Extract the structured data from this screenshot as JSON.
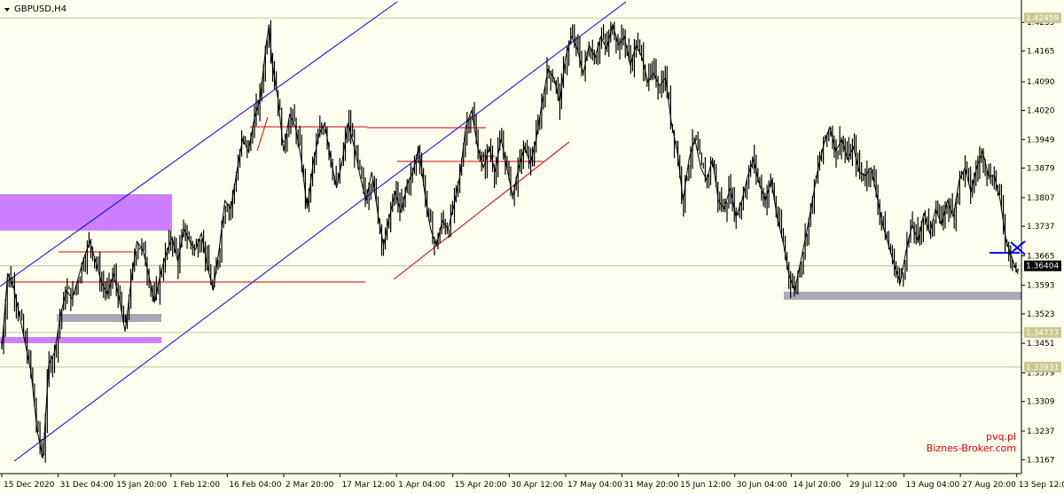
{
  "chart_data": {
    "type": "line",
    "title": "GBPUSD,H4",
    "xlabel": "",
    "ylabel": "",
    "ylim": [
      1.3133,
      1.4281
    ],
    "grid": false,
    "legend": "none",
    "x_ticks": [
      "15 Dec 2020",
      "31 Dec 04:00",
      "15 Jan 20:00",
      "1 Feb 12:00",
      "16 Feb 04:00",
      "2 Mar 20:00",
      "17 Mar 12:00",
      "1 Apr 04:00",
      "15 Apr 20:00",
      "30 Apr 12:00",
      "17 May 04:00",
      "31 May 20:00",
      "15 Jun 12:00",
      "30 Jun 04:00",
      "14 Jul 20:00",
      "29 Jul 12:00",
      "13 Aug 04:00",
      "27 Aug 20:00",
      "13 Sep 12:00"
    ],
    "y_ticks": [
      1.4235,
      1.4165,
      1.409,
      1.402,
      1.3949,
      1.3879,
      1.3807,
      1.3737,
      1.3665,
      1.3593,
      1.3523,
      1.3451,
      1.3379,
      1.3309,
      1.3237,
      1.3167
    ],
    "series": [
      {
        "values": [
          [
            0,
            1.344
          ],
          [
            2,
            1.362
          ],
          [
            4,
            1.359
          ],
          [
            6,
            1.352
          ],
          [
            8,
            1.345
          ],
          [
            10,
            1.338
          ],
          [
            12,
            1.324
          ],
          [
            14,
            1.317
          ],
          [
            16,
            1.34
          ],
          [
            18,
            1.343
          ],
          [
            20,
            1.352
          ],
          [
            22,
            1.358
          ],
          [
            24,
            1.356
          ],
          [
            26,
            1.361
          ],
          [
            28,
            1.366
          ],
          [
            30,
            1.37
          ],
          [
            32,
            1.365
          ],
          [
            34,
            1.36
          ],
          [
            36,
            1.357
          ],
          [
            38,
            1.362
          ],
          [
            40,
            1.356
          ],
          [
            42,
            1.348
          ],
          [
            44,
            1.36
          ],
          [
            46,
            1.37
          ],
          [
            48,
            1.368
          ],
          [
            50,
            1.362
          ],
          [
            52,
            1.355
          ],
          [
            54,
            1.362
          ],
          [
            56,
            1.367
          ],
          [
            58,
            1.371
          ],
          [
            60,
            1.365
          ],
          [
            62,
            1.373
          ],
          [
            64,
            1.37
          ],
          [
            66,
            1.368
          ],
          [
            68,
            1.372
          ],
          [
            70,
            1.364
          ],
          [
            72,
            1.358
          ],
          [
            74,
            1.368
          ],
          [
            76,
            1.38
          ],
          [
            78,
            1.378
          ],
          [
            80,
            1.387
          ],
          [
            82,
            1.395
          ],
          [
            84,
            1.392
          ],
          [
            86,
            1.4
          ],
          [
            88,
            1.405
          ],
          [
            90,
            1.418
          ],
          [
            91,
            1.423
          ],
          [
            92,
            1.414
          ],
          [
            94,
            1.405
          ],
          [
            96,
            1.392
          ],
          [
            98,
            1.401
          ],
          [
            100,
            1.398
          ],
          [
            102,
            1.39
          ],
          [
            104,
            1.378
          ],
          [
            106,
            1.389
          ],
          [
            108,
            1.396
          ],
          [
            110,
            1.399
          ],
          [
            112,
            1.39
          ],
          [
            114,
            1.383
          ],
          [
            116,
            1.39
          ],
          [
            118,
            1.399
          ],
          [
            120,
            1.393
          ],
          [
            122,
            1.386
          ],
          [
            124,
            1.38
          ],
          [
            126,
            1.387
          ],
          [
            128,
            1.377
          ],
          [
            130,
            1.369
          ],
          [
            132,
            1.376
          ],
          [
            134,
            1.382
          ],
          [
            136,
            1.377
          ],
          [
            138,
            1.384
          ],
          [
            140,
            1.387
          ],
          [
            142,
            1.393
          ],
          [
            144,
            1.382
          ],
          [
            146,
            1.373
          ],
          [
            148,
            1.369
          ],
          [
            150,
            1.375
          ],
          [
            152,
            1.373
          ],
          [
            154,
            1.379
          ],
          [
            156,
            1.386
          ],
          [
            158,
            1.398
          ],
          [
            160,
            1.402
          ],
          [
            162,
            1.393
          ],
          [
            164,
            1.388
          ],
          [
            166,
            1.393
          ],
          [
            168,
            1.387
          ],
          [
            170,
            1.395
          ],
          [
            172,
            1.388
          ],
          [
            174,
            1.381
          ],
          [
            176,
            1.388
          ],
          [
            178,
            1.393
          ],
          [
            180,
            1.389
          ],
          [
            182,
            1.395
          ],
          [
            184,
            1.404
          ],
          [
            186,
            1.412
          ],
          [
            188,
            1.41
          ],
          [
            190,
            1.404
          ],
          [
            192,
            1.415
          ],
          [
            194,
            1.42
          ],
          [
            196,
            1.417
          ],
          [
            198,
            1.411
          ],
          [
            200,
            1.418
          ],
          [
            202,
            1.415
          ],
          [
            204,
            1.42
          ],
          [
            206,
            1.417
          ],
          [
            208,
            1.423
          ],
          [
            210,
            1.418
          ],
          [
            212,
            1.42
          ],
          [
            214,
            1.413
          ],
          [
            216,
            1.418
          ],
          [
            218,
            1.415
          ],
          [
            220,
            1.409
          ],
          [
            222,
            1.411
          ],
          [
            224,
            1.408
          ],
          [
            226,
            1.41
          ],
          [
            228,
            1.399
          ],
          [
            230,
            1.392
          ],
          [
            232,
            1.38
          ],
          [
            234,
            1.39
          ],
          [
            236,
            1.395
          ],
          [
            238,
            1.388
          ],
          [
            240,
            1.385
          ],
          [
            242,
            1.39
          ],
          [
            244,
            1.38
          ],
          [
            246,
            1.378
          ],
          [
            248,
            1.383
          ],
          [
            250,
            1.376
          ],
          [
            252,
            1.38
          ],
          [
            254,
            1.386
          ],
          [
            256,
            1.39
          ],
          [
            258,
            1.384
          ],
          [
            260,
            1.38
          ],
          [
            262,
            1.385
          ],
          [
            264,
            1.376
          ],
          [
            266,
            1.37
          ],
          [
            268,
            1.362
          ],
          [
            270,
            1.358
          ],
          [
            272,
            1.365
          ],
          [
            274,
            1.372
          ],
          [
            276,
            1.38
          ],
          [
            278,
            1.388
          ],
          [
            280,
            1.394
          ],
          [
            282,
            1.398
          ],
          [
            284,
            1.392
          ],
          [
            286,
            1.395
          ],
          [
            288,
            1.39
          ],
          [
            290,
            1.393
          ],
          [
            292,
            1.387
          ],
          [
            294,
            1.386
          ],
          [
            296,
            1.388
          ],
          [
            298,
            1.381
          ],
          [
            300,
            1.374
          ],
          [
            302,
            1.369
          ],
          [
            304,
            1.364
          ],
          [
            306,
            1.36
          ],
          [
            308,
            1.368
          ],
          [
            310,
            1.374
          ],
          [
            312,
            1.37
          ],
          [
            314,
            1.377
          ],
          [
            316,
            1.372
          ],
          [
            318,
            1.378
          ],
          [
            320,
            1.374
          ],
          [
            322,
            1.38
          ],
          [
            324,
            1.376
          ],
          [
            326,
            1.385
          ],
          [
            328,
            1.388
          ],
          [
            330,
            1.382
          ],
          [
            332,
            1.388
          ],
          [
            334,
            1.392
          ],
          [
            336,
            1.386
          ],
          [
            338,
            1.386
          ],
          [
            340,
            1.38
          ],
          [
            342,
            1.37
          ],
          [
            344,
            1.366
          ],
          [
            346,
            1.362
          ]
        ]
      }
    ],
    "levels": [
      {
        "price": 1.42459,
        "label": "1.42459"
      },
      {
        "price": 1.34777,
        "label": "1.34777"
      },
      {
        "price": 1.33931,
        "label": "1.33931"
      }
    ],
    "current_price": {
      "price": 1.36404,
      "label": "1.36404"
    },
    "colors": {
      "background": "#ffffef",
      "price": "#000000",
      "channel": "#0000ff",
      "resistance": "#cc0000",
      "zone_purple": "#cc80ff",
      "zone_gray": "#a8a8b8",
      "level": "#c8c890",
      "tag": "#c8c890"
    },
    "watermark": [
      "pvq.pl",
      "Biznes-Broker.com"
    ]
  }
}
